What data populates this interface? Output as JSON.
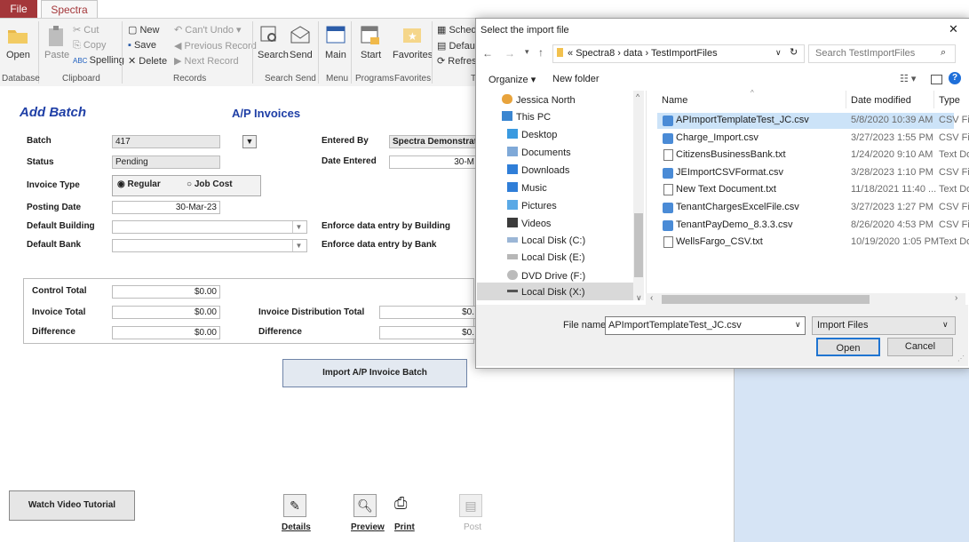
{
  "ribbon": {
    "tabs": [
      "File",
      "Spectra"
    ],
    "open_label": "Open",
    "paste_label": "Paste",
    "cut_label": "Cut",
    "copy_label": "Copy",
    "spelling_label": "Spelling",
    "new_label": "New",
    "save_label": "Save",
    "delete_label": "Delete",
    "undo_label": "Can't Undo",
    "prev_label": "Previous Record",
    "next_label": "Next Record",
    "search_label": "Search",
    "send_label": "Send",
    "main_label": "Main",
    "start_label": "Start",
    "favorites_label": "Favorites",
    "sched_label": "Schedu",
    "default_label": "Defaul",
    "refresh_label": "Refres",
    "groups": [
      "Database",
      "Clipboard",
      "Records",
      "Search Send",
      "Menu",
      "Programs",
      "Favorites",
      "T"
    ]
  },
  "form": {
    "title": "Add Batch",
    "subtitle": "A/P Invoices",
    "batch_label": "Batch",
    "batch_value": "417",
    "status_label": "Status",
    "status_value": "Pending",
    "entered_by_label": "Entered By",
    "entered_by_value": "Spectra Demonstrati",
    "date_entered_label": "Date Entered",
    "date_entered_value": "30-M",
    "invoice_type_label": "Invoice Type",
    "regular_label": "Regular",
    "job_cost_label": "Job Cost",
    "posting_date_label": "Posting Date",
    "posting_date_value": "30-Mar-23",
    "default_building_label": "Default Building",
    "default_bank_label": "Default Bank",
    "enforce_building_label": "Enforce data entry by Building",
    "enforce_bank_label": "Enforce data entry by Bank",
    "control_total_label": "Control Total",
    "control_total_value": "$0.00",
    "invoice_total_label": "Invoice Total",
    "invoice_total_value": "$0.00",
    "difference_label": "Difference",
    "difference_value": "$0.00",
    "dist_total_label": "Invoice Distribution Total",
    "dist_total_value": "$0.",
    "difference2_label": "Difference",
    "difference2_value": "$0.",
    "import_button": "Import A/P Invoice Batch",
    "watch_video": "Watch Video Tutorial",
    "details": "Details",
    "preview": "Preview",
    "print": "Print",
    "post": "Post"
  },
  "dialog": {
    "title": "Select the import file",
    "close": "✕",
    "path": [
      "«",
      "Spectra8",
      "data",
      "TestImportFiles"
    ],
    "search_placeholder": "Search TestImportFiles",
    "organize": "Organize",
    "new_folder": "New folder",
    "nav_items": [
      "Jessica North",
      "This PC",
      "Desktop",
      "Documents",
      "Downloads",
      "Music",
      "Pictures",
      "Videos",
      "Local Disk (C:)",
      "Local Disk (E:)",
      "DVD Drive (F:)",
      "Local Disk (X:)"
    ],
    "columns": [
      "Name",
      "Date modified",
      "Type"
    ],
    "files": [
      {
        "name": "APImportTemplateTest_JC.csv",
        "date": "5/8/2020 10:39 AM",
        "type": "CSV Fil"
      },
      {
        "name": "Charge_Import.csv",
        "date": "3/27/2023 1:55 PM",
        "type": "CSV Fil"
      },
      {
        "name": "CitizensBusinessBank.txt",
        "date": "1/24/2020 9:10 AM",
        "type": "Text Do"
      },
      {
        "name": "JEImportCSVFormat.csv",
        "date": "3/28/2023 1:10 PM",
        "type": "CSV Fil"
      },
      {
        "name": "New Text Document.txt",
        "date": "11/18/2021 11:40 ...",
        "type": "Text Do"
      },
      {
        "name": "TenantChargesExcelFile.csv",
        "date": "3/27/2023 1:27 PM",
        "type": "CSV Fil"
      },
      {
        "name": "TenantPayDemo_8.3.3.csv",
        "date": "8/26/2020 4:53 PM",
        "type": "CSV Fil"
      },
      {
        "name": "WellsFargo_CSV.txt",
        "date": "10/19/2020 1:05 PM",
        "type": "Text Do"
      }
    ],
    "file_name_label": "File name:",
    "file_name_value": "APImportTemplateTest_JC.csv",
    "filter_value": "Import Files",
    "open_button": "Open",
    "cancel_button": "Cancel"
  }
}
